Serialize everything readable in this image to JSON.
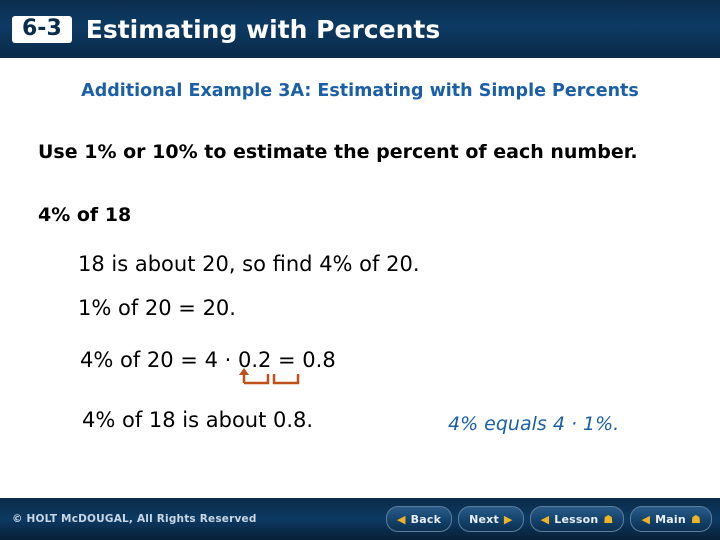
{
  "header": {
    "lesson_number": "6-3",
    "title": "Estimating with Percents"
  },
  "content": {
    "example_title": "Additional Example 3A: Estimating with Simple Percents",
    "instruction": "Use 1% or 10% to estimate the percent of each number.",
    "problem": "4% of 18",
    "steps": [
      "18 is about 20, so find 4% of 20.",
      "1% of 20 = 20.",
      "4% of 20 = 4 · 0.2 = 0.8",
      "4% of 18 is about 0.8."
    ],
    "note": "4% equals 4 · 1%.",
    "arrow_icon": "decimal-shift-arrow"
  },
  "footer": {
    "copyright": "© HOLT McDOUGAL, All Rights Reserved",
    "buttons": [
      {
        "label": "Back",
        "icon": "chevron-left-icon"
      },
      {
        "label": "Next",
        "icon": "chevron-right-icon"
      },
      {
        "label": "Lesson",
        "icon": "home-icon"
      },
      {
        "label": "Main",
        "icon": "home-icon"
      }
    ]
  },
  "colors": {
    "header_bg": "#0d3a63",
    "accent_blue": "#1a5fa8",
    "gold": "#f0b323",
    "arrow_orange": "#c0501a"
  }
}
